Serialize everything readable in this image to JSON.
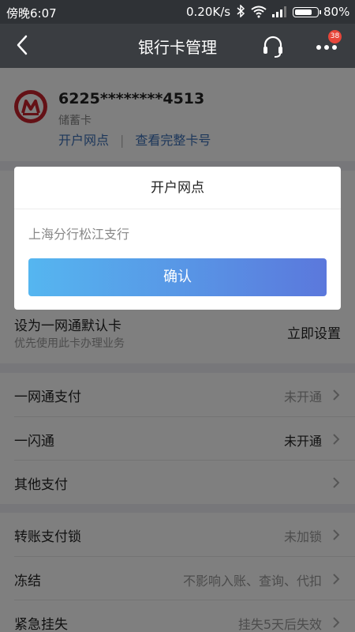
{
  "status_bar": {
    "time": "傍晚6:07",
    "network_speed": "0.20K/s",
    "battery_percent": "80%",
    "battery_level": 0.8,
    "icons": [
      "bluetooth-icon",
      "wifi-icon",
      "signal-icon",
      "battery-icon"
    ]
  },
  "nav": {
    "title": "银行卡管理",
    "back_icon": "back-arrow-icon",
    "service_icon": "headset-icon",
    "more_icon": "more-dots-icon",
    "badge_count": "38"
  },
  "card": {
    "number": "6225********4513",
    "type": "储蓄卡",
    "link_branch": "开户网点",
    "link_separator": "|",
    "link_full_number": "查看完整卡号",
    "brand_color": "#c8232c"
  },
  "default_card": {
    "label": "设为一网通默认卡",
    "sub": "优先使用此卡办理业务",
    "action": "立即设置"
  },
  "rows_group1": [
    {
      "label": "一网通支付",
      "value": "未开通",
      "value_dark": false
    },
    {
      "label": "一闪通",
      "value": "未开通",
      "value_dark": true
    },
    {
      "label": "其他支付",
      "value": "",
      "value_dark": false
    }
  ],
  "rows_group2": [
    {
      "label": "转账支付锁",
      "value": "未加锁"
    },
    {
      "label": "冻结",
      "value": "不影响入账、查询、代扣"
    },
    {
      "label": "紧急挂失",
      "value": "挂失5天后失效"
    }
  ],
  "dialog": {
    "title": "开户网点",
    "body": "上海分行松江支行",
    "confirm": "确认",
    "gradient_start": "#55b6f0",
    "gradient_end": "#5b78dc"
  }
}
